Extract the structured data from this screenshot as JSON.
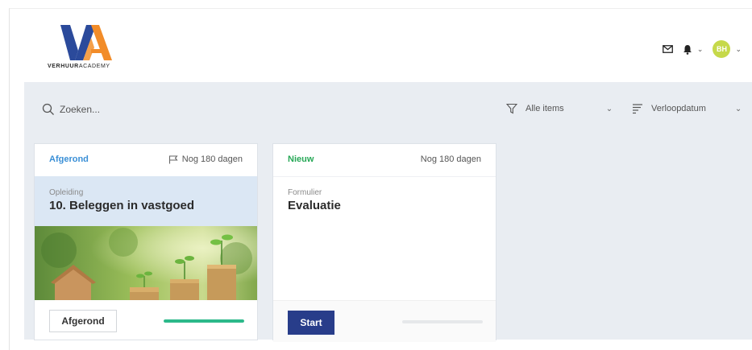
{
  "brand": {
    "name_bold": "VERHUUR",
    "name_rest": "ACADEMY",
    "logo_letters": "VA"
  },
  "header": {
    "icons": [
      "mail-icon",
      "bell-icon",
      "chevron-down-icon",
      "avatar",
      "chevron-down-icon"
    ],
    "avatar_initials": "BH",
    "avatar_color": "#c6d94a"
  },
  "toolbar": {
    "search_placeholder": "Zoeken...",
    "filter_label": "Alle items",
    "sort_label": "Verloopdatum"
  },
  "cards": [
    {
      "status": "Afgerond",
      "status_color": "#3a8fd6",
      "days": "Nog 180 dagen",
      "type": "Opleiding",
      "title": "10. Beleggen in vastgoed",
      "image": "house-and-coins-photo",
      "button": "Afgerond",
      "progress": 1.0
    },
    {
      "status": "Nieuw",
      "status_color": "#27a857",
      "days": "Nog 180 dagen",
      "type": "Formulier",
      "title": "Evaluatie",
      "button": "Start",
      "progress": 0.0
    }
  ]
}
